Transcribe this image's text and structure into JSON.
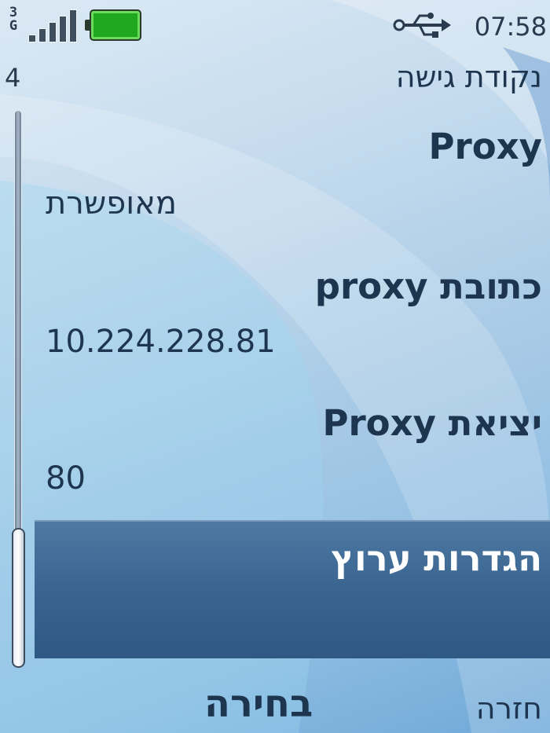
{
  "status_bar": {
    "network_type": "3G",
    "signal_level": 5,
    "battery_level": 1.0,
    "battery_color": "#1fa81f",
    "usb_icon": "usb-icon",
    "time": "07:58"
  },
  "header": {
    "title": "נקודת גישה",
    "item_count": "4"
  },
  "settings": [
    {
      "label": "Proxy",
      "value": "מאופשרת"
    },
    {
      "label": "כתובת proxy",
      "value": "10.224.228.81"
    },
    {
      "label": "יציאת Proxy",
      "value": "80"
    }
  ],
  "selected_item": {
    "label": "הגדרות ערוץ"
  },
  "softkeys": {
    "select": "בחירה",
    "back": "חזרה"
  },
  "colors": {
    "highlight": "#3a6590",
    "text": "#1e3550"
  }
}
